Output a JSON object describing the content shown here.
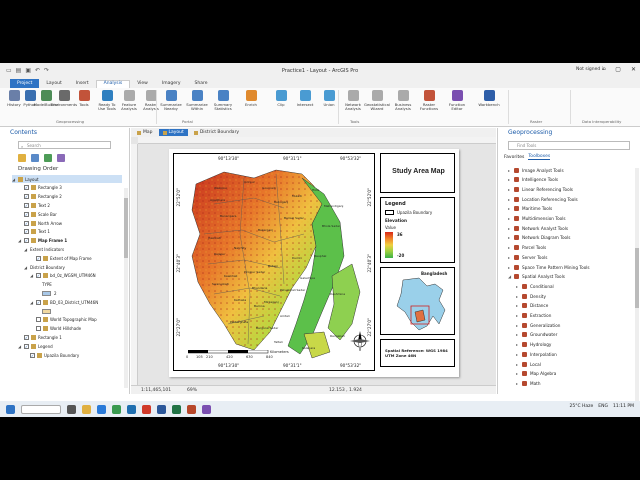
{
  "window": {
    "title": "Practice1 - Layout - ArcGIS Pro",
    "signin": "Not signed in"
  },
  "ribbon": {
    "tabs": [
      "Project",
      "Layout",
      "Insert",
      "Analysis",
      "View",
      "Imagery",
      "Share"
    ],
    "active_tab": "Analysis",
    "buttons": [
      {
        "label": "History",
        "color": "#6a7fa8"
      },
      {
        "label": "Python",
        "color": "#3a6fb0"
      },
      {
        "label": "ModelBuilder",
        "color": "#4d8c57"
      },
      {
        "label": "Environments",
        "color": "#6a6a6a"
      },
      {
        "label": "Tools",
        "color": "#c2533a"
      },
      {
        "label": "Ready To Use Tools",
        "color": "#2f7fc0"
      },
      {
        "label": "Feature Analysis",
        "color": "#aaaaaa"
      },
      {
        "label": "Raster Analysis",
        "color": "#aaaaaa"
      },
      {
        "label": "Summarize Nearby",
        "color": "#4a82c4"
      },
      {
        "label": "Summarize Within",
        "color": "#4a82c4"
      },
      {
        "label": "Summary Statistics",
        "color": "#4a82c4"
      },
      {
        "label": "Enrich",
        "color": "#e08a2e"
      },
      {
        "label": "Clip",
        "color": "#4a9bd2"
      },
      {
        "label": "Intersect",
        "color": "#4a9bd2"
      },
      {
        "label": "Union",
        "color": "#4a9bd2"
      },
      {
        "label": "Network Analysis",
        "color": "#aaaaaa"
      },
      {
        "label": "Geostatistical Wizard",
        "color": "#aaaaaa"
      },
      {
        "label": "Business Analysis",
        "color": "#aaaaaa"
      },
      {
        "label": "Raster Functions",
        "color": "#c2533a"
      },
      {
        "label": "Function Editor",
        "color": "#7a4fb0"
      },
      {
        "label": "Workbench",
        "color": "#2e5ea8"
      }
    ],
    "groups": [
      "Geoprocessing",
      "Portal",
      "Tools",
      "Raster",
      "Data Interoperability"
    ]
  },
  "contents": {
    "title": "Contents",
    "search_placeholder": "Search",
    "drawing_order": "Drawing Order",
    "items": [
      {
        "label": "Layout",
        "level": 0,
        "check": false,
        "toggle": "◢",
        "selected": true
      },
      {
        "label": "Rectangle 3",
        "level": 1,
        "check": true
      },
      {
        "label": "Rectangle 2",
        "level": 1,
        "check": true
      },
      {
        "label": "Text 2",
        "level": 1,
        "check": true
      },
      {
        "label": "Scale Bar",
        "level": 1,
        "check": true
      },
      {
        "label": "North Arrow",
        "level": 1,
        "check": true
      },
      {
        "label": "Text 1",
        "level": 1,
        "check": true
      },
      {
        "label": "Map Frame 1",
        "level": 1,
        "check": true,
        "toggle": "◢",
        "bold": true
      },
      {
        "label": "Extent Indicators",
        "level": 2,
        "check": false,
        "toggle": "◢",
        "nobox": true
      },
      {
        "label": "Extent of Map Frame",
        "level": 3,
        "check": true
      },
      {
        "label": "District Boundary",
        "level": 2,
        "check": false,
        "toggle": "◢",
        "nobox": true
      },
      {
        "label": "bd_0z_WGSM_UTM46N",
        "level": 3,
        "check": true,
        "toggle": "◢"
      },
      {
        "label": "TYPE",
        "level": 4,
        "check": false,
        "nobox": true
      },
      {
        "label": "2",
        "level": 4,
        "check": false,
        "swatch": "#a8c8e8"
      },
      {
        "label": "BD_03_District_UTM46N",
        "level": 3,
        "check": true,
        "toggle": "◢"
      },
      {
        "label": "",
        "level": 4,
        "check": false,
        "swatch": "#f0d8a0"
      },
      {
        "label": "World Topographic Map",
        "level": 3,
        "check": false
      },
      {
        "label": "World Hillshade",
        "level": 3,
        "check": false
      },
      {
        "label": "Rectangle 1",
        "level": 1,
        "check": true
      },
      {
        "label": "Legend",
        "level": 1,
        "check": true,
        "toggle": "◢"
      },
      {
        "label": "Upazila Boundary",
        "level": 2,
        "check": true
      }
    ]
  },
  "doc_tabs": [
    {
      "label": "Map",
      "active": false
    },
    {
      "label": "Layout",
      "active": true
    },
    {
      "label": "District Boundary",
      "active": false
    }
  ],
  "layout": {
    "lon_labels": [
      "90°13'30\"",
      "90°31'1\"",
      "90°53'32\""
    ],
    "lat_labels": [
      "22°52'0\"",
      "22°40'3\"",
      "22°27'0\""
    ],
    "scale_ticks": [
      "0",
      "105",
      "210",
      "420",
      "630",
      "840"
    ],
    "scale_unit": "Kilometers",
    "places": [
      "Wazirpur",
      "Uzirpur",
      "Agailjhara",
      "Gournadi",
      "Babuganj",
      "Barisal Sadar",
      "Bakerganj",
      "Banaripara",
      "Jhalokati",
      "Rajapur",
      "Nalchity",
      "Bhola Sadar",
      "Muladi",
      "Hizla",
      "Mehendiganj",
      "Pirojpur Sadar",
      "Kawkhali",
      "Bhandaria",
      "Swarupkati",
      "Kathalia",
      "Betagi",
      "Bamna",
      "Patharghata",
      "Barguna Sadar",
      "Amtali",
      "Taltali",
      "Galachipa",
      "Patuakhali Sadar",
      "Mirzaganj",
      "Dumki",
      "Bauphal",
      "Dashmina",
      "Kalapara",
      "Rangabali"
    ],
    "map_title": "Study Area Map",
    "legend": {
      "title": "Legend",
      "boundary": "Upazila Boundary",
      "elevation": "Elevation",
      "value": "Value",
      "high": "36",
      "low": "-20"
    },
    "inset_label": "Bangladesh",
    "spatial_ref": "Spatial Reference: WGS 1984 UTM Zone 46N"
  },
  "status": {
    "scale": "1:11,465,101",
    "zoom": "69%",
    "coords": "12.153 , 1.924"
  },
  "geoprocessing": {
    "title": "Geoprocessing",
    "search_value": "Find Tools",
    "tabs": [
      "Favorites",
      "Toolboxes"
    ],
    "toolboxes": [
      "Image Analyst Tools",
      "Intelligence Tools",
      "Linear Referencing Tools",
      "Location Referencing Tools",
      "Maritime Tools",
      "Multidimension Tools",
      "Network Analyst Tools",
      "Network Diagram Tools",
      "Parcel Tools",
      "Server Tools",
      "Space Time Pattern Mining Tools",
      "Spatial Analyst Tools"
    ],
    "spatial_analyst": [
      "Conditional",
      "Density",
      "Distance",
      "Extraction",
      "Generalization",
      "Groundwater",
      "Hydrology",
      "Interpolation",
      "Local",
      "Map Algebra",
      "Math"
    ],
    "bottom_tabs": [
      "Catalog",
      "Symbology",
      "Geoprocessing",
      "Element",
      "Export"
    ],
    "active_bottom": "Geoprocessing"
  },
  "taskbar": {
    "temp": "25°C Haze",
    "lang": "ENG",
    "time": "11:11 PM"
  }
}
